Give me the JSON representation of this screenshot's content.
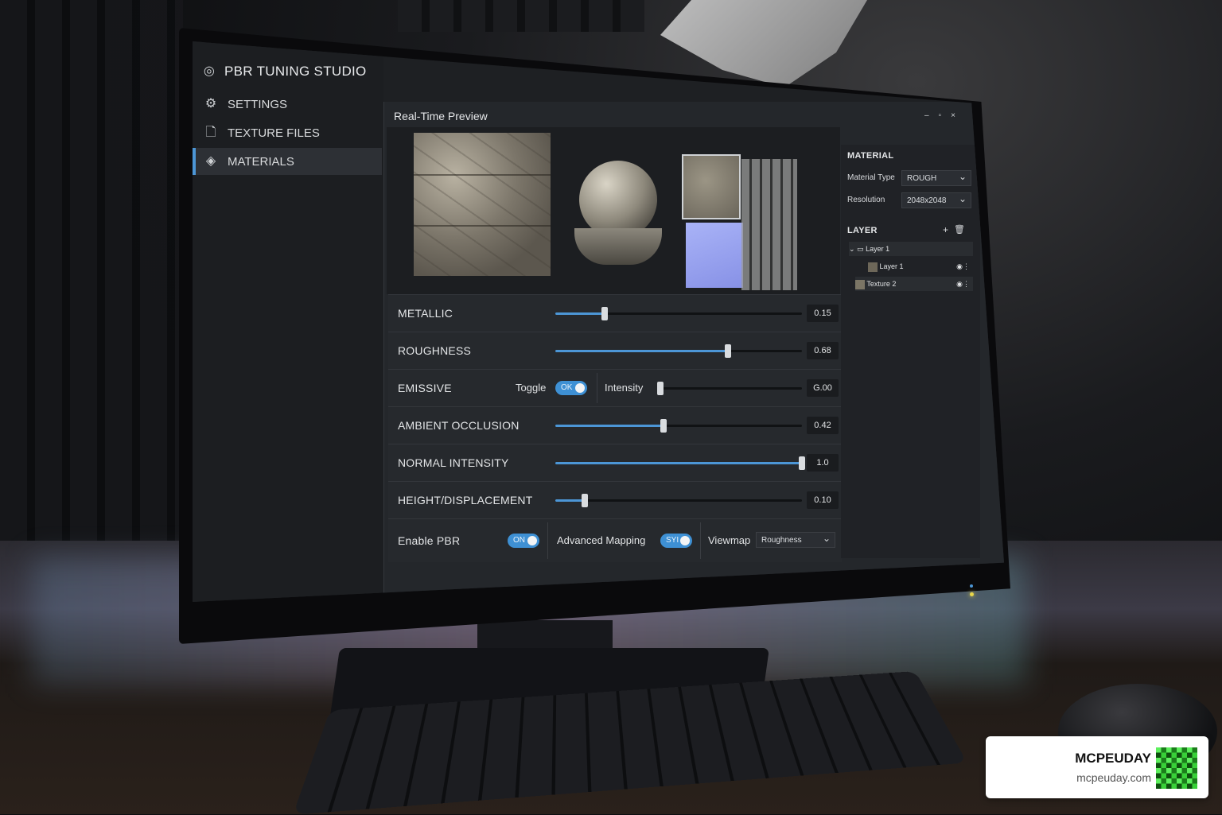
{
  "app": {
    "title": "PBR TUNING STUDIO"
  },
  "sidebar": {
    "items": [
      {
        "label": "SETTINGS",
        "icon": "gear-icon"
      },
      {
        "label": "TEXTURE FILES",
        "icon": "file-icon"
      },
      {
        "label": "MATERIALS",
        "icon": "layers-icon",
        "active": true
      }
    ]
  },
  "preview": {
    "title": "Real-Time Preview"
  },
  "sliders": {
    "metallic": {
      "label": "METALLIC",
      "value": "0.15",
      "level": 0.2
    },
    "roughness": {
      "label": "ROUGHNESS",
      "value": "0.68",
      "level": 0.7
    },
    "emissive": {
      "label": "EMISSIVE",
      "toggle_label": "Toggle",
      "toggle_state": "OK",
      "intensity_label": "Intensity",
      "value": "G.00",
      "level": 0.0
    },
    "ao": {
      "label": "AMBIENT OCCLUSION",
      "value": "0.42",
      "level": 0.44
    },
    "normal": {
      "label": "NORMAL INTENSITY",
      "value": "1.0",
      "level": 1.0
    },
    "height": {
      "label": "HEIGHT/DISPLACEMENT",
      "value": "0.10",
      "level": 0.12
    }
  },
  "bottom_row": {
    "enable_pbr": {
      "label": "Enable PBR",
      "state": "ON"
    },
    "advanced_mapping": {
      "label": "Advanced Mapping",
      "state": "SYI"
    },
    "viewmap": {
      "label": "Viewmap",
      "selected": "Roughness"
    }
  },
  "material_panel": {
    "heading": "MATERIAL",
    "type_label": "Material Type",
    "type_value": "ROUGH",
    "resolution_label": "Resolution",
    "resolution_value": "2048x2048"
  },
  "layer_panel": {
    "heading": "LAYER",
    "layers": [
      {
        "name": "Layer 1",
        "kind": "folder"
      },
      {
        "name": "Layer 1",
        "kind": "child"
      },
      {
        "name": "Texture 2",
        "kind": "child"
      }
    ]
  },
  "watermark": {
    "title": "MCPEUDAY",
    "url": "mcpeuday.com"
  },
  "colors": {
    "accent": "#4c96d6",
    "panel": "#24272b",
    "sidebar": "#1c1e21"
  }
}
